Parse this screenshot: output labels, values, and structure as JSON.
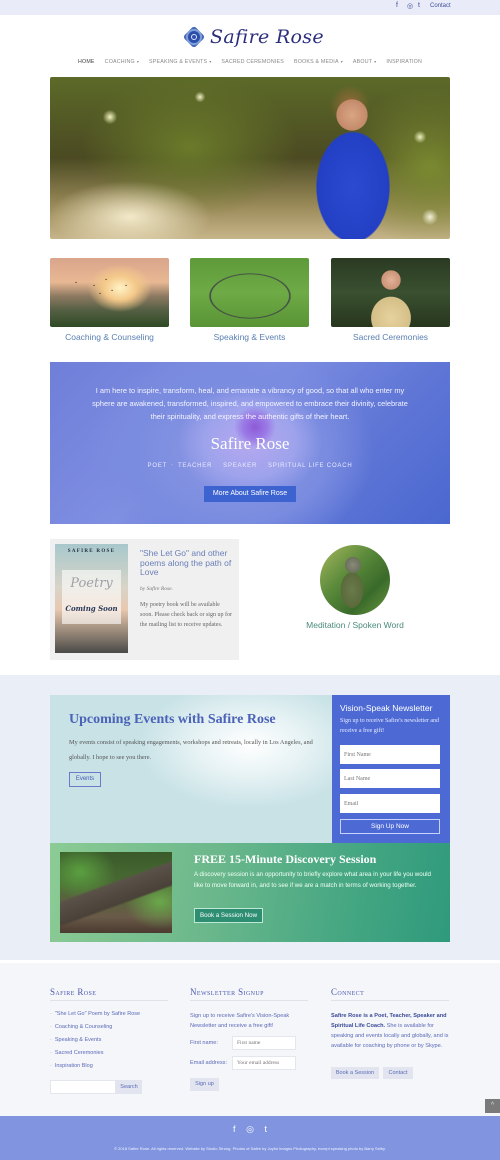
{
  "topbar": {
    "social": [
      "facebook-icon",
      "instagram-icon",
      "twitter-icon"
    ],
    "social_glyphs": [
      "f",
      "◎",
      "t"
    ],
    "contact": "Contact"
  },
  "logo": {
    "text": "Safire Rose"
  },
  "nav": {
    "items": [
      {
        "label": "Home",
        "dropdown": false
      },
      {
        "label": "Coaching",
        "dropdown": true
      },
      {
        "label": "Speaking & Events",
        "dropdown": true
      },
      {
        "label": "Sacred Ceremonies",
        "dropdown": false
      },
      {
        "label": "Books & Media",
        "dropdown": true
      },
      {
        "label": "About",
        "dropdown": true
      },
      {
        "label": "Inspiration",
        "dropdown": false
      }
    ],
    "caret": "▾"
  },
  "cards": [
    {
      "label": "Coaching & Counseling"
    },
    {
      "label": "Speaking & Events"
    },
    {
      "label": "Sacred Ceremonies"
    }
  ],
  "rose": {
    "quote": "I am here to inspire, transform, heal, and emanate a vibrancy of good, so that all who enter my sphere are awakened, transformed, inspired, and empowered to embrace their divinity, celebrate their spirituality, and express the authentic gifts of their heart.",
    "name": "Safire Rose",
    "roles": [
      "POET",
      "TEACHER",
      "SPEAKER",
      "SPIRITUAL LIFE COACH"
    ],
    "separator": "•",
    "button": "More About Safire Rose"
  },
  "book": {
    "cover_author": "SAFIRE ROSE",
    "cover_title": "Poetry",
    "cover_subtitle": "Coming Soon",
    "title": "\"She Let Go\" and other poems along the path of  Love",
    "byline": "by Safire Rose.",
    "description": "My poetry book will be available soon. Please check back or sign up for the mailing list to receive  updates."
  },
  "meditation": {
    "label": "Meditation / Spoken Word"
  },
  "events": {
    "title": "Upcoming Events with Safire Rose",
    "description": "My events consist of speaking engagements, workshops and retreats, locally in Los Angeles, and globally. I hope to see you there.",
    "button": "Events"
  },
  "newsletter": {
    "title": "Vision-Speak Newsletter",
    "subtitle": "Sign up to receive Safire's newsletter and receive a free gift!",
    "fields": [
      {
        "placeholder": "First Name",
        "value": ""
      },
      {
        "placeholder": "Last Name",
        "value": ""
      },
      {
        "placeholder": "Email",
        "value": ""
      }
    ],
    "submit": "Sign Up Now"
  },
  "discovery": {
    "title": "FREE 15-Minute Discovery Session",
    "description": "A discovery session is an opportunity to briefly explore what area in your life you would like to move forward in, and to see if we are a match in terms of working together.",
    "button": "Book a Session Now"
  },
  "footer": {
    "col1": {
      "title": "Safire Rose",
      "links": [
        "\"She Let Go\" Poem by Safire Rose",
        "Coaching & Counseling",
        "Speaking & Events",
        "Sacred Ceremonies",
        "Inspiration Blog"
      ],
      "search_value": "",
      "search_button": "Search"
    },
    "col2": {
      "title": "Newsletter Signup",
      "text": "Sign up to receive Safire's Vision-Speak Newsletter and receive a free gift!",
      "first_name_label": "First name:",
      "first_name_placeholder": "First name",
      "email_label": "Email address:",
      "email_placeholder": "Your email address",
      "button": "Sign up"
    },
    "col3": {
      "title": "Connect",
      "bold_text": "Safire Rose is a Poet, Teacher, Speaker and Spiritual Life Coach.",
      "text": " She is available for speaking and events locally and globally, and is available for coaching by phone or by Skype.",
      "buttons": [
        "Book a Session",
        "Contact"
      ]
    }
  },
  "back_to_top": "^",
  "bottombar": {
    "social": [
      "facebook-icon",
      "instagram-icon",
      "twitter-icon"
    ],
    "social_glyphs": [
      "f",
      "◎",
      "t"
    ],
    "copyright": "© 2018 Safire Rose. All rights reserved. Website by Studio Strong. Photos of Safire by Joyful Images Photography, except speaking photo by Barry Selby."
  }
}
